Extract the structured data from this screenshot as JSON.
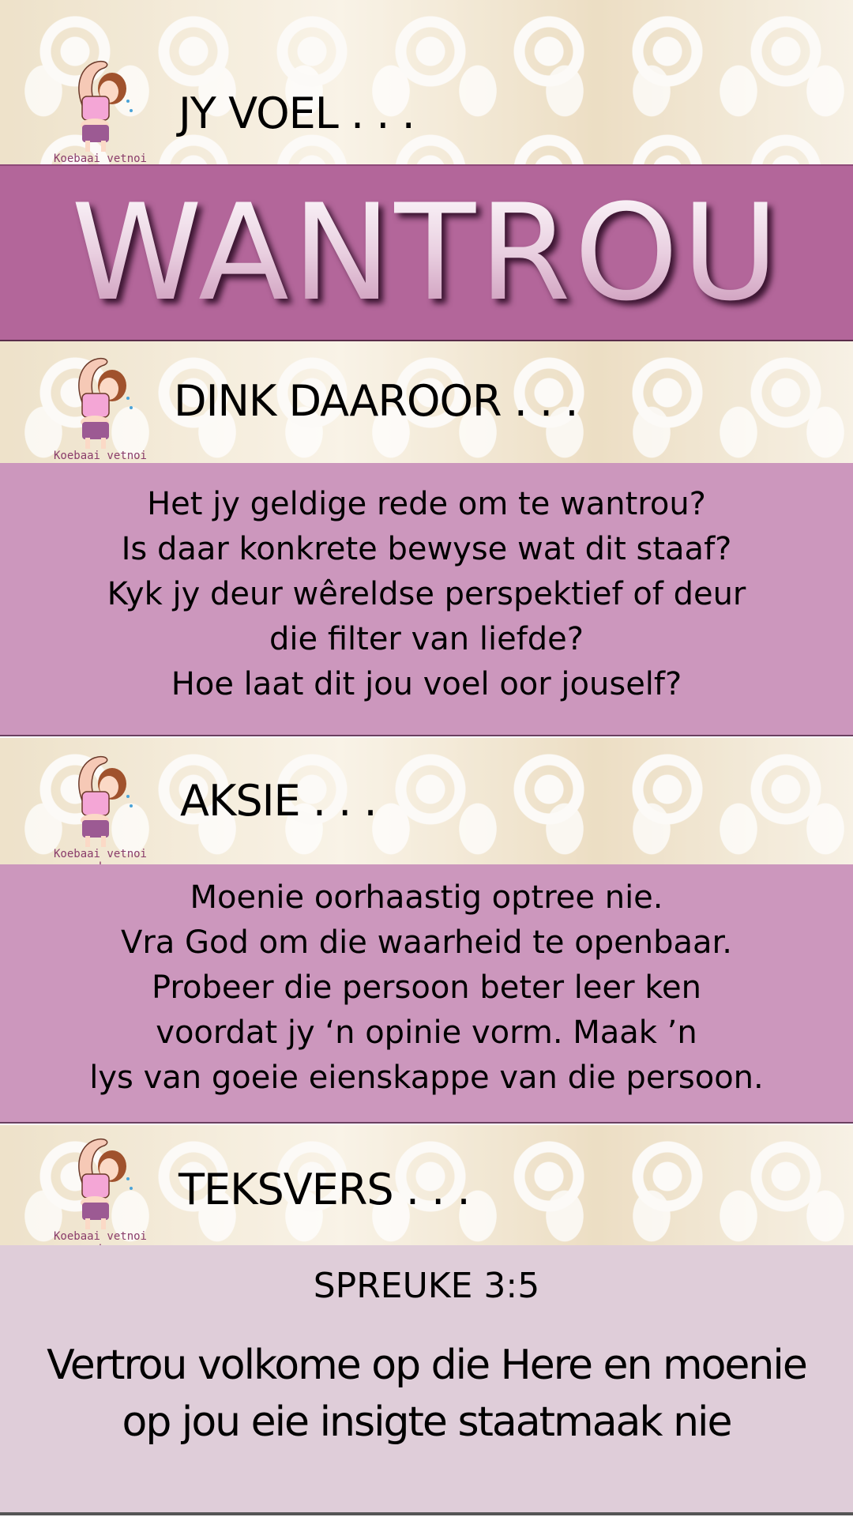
{
  "mascot_caption": "Koebaai vetnoi !",
  "sections": {
    "feel": {
      "heading": "JY VOEL . . .",
      "word": "WANTROU"
    },
    "think": {
      "heading": "DINK DAAROOR . . .",
      "lines": [
        "Het jy geldige rede om te wantrou?",
        "Is daar konkrete bewyse wat dit staaf?",
        "Kyk jy deur wêreldse perspektief of deur",
        "die filter van liefde?",
        "Hoe laat dit jou voel oor jouself?"
      ]
    },
    "action": {
      "heading": "AKSIE . . .",
      "lines": [
        "Moenie oorhaastig optree nie.",
        "Vra God om die waarheid te openbaar.",
        "Probeer die persoon beter leer ken",
        "voordat jy ‘n opinie vorm. Maak ’n",
        "lys van goeie eienskappe van die persoon."
      ]
    },
    "verse": {
      "heading": "TEKSVERS . . .",
      "reference": "SPREUKE 3:5",
      "lines": [
        "Vertrou volkome op die Here en moenie",
        "op jou eie insigte staatmaak nie"
      ]
    }
  },
  "colors": {
    "band": "#b3669a",
    "box": "#cc97bd",
    "verse_box": "#dfcdd9"
  }
}
